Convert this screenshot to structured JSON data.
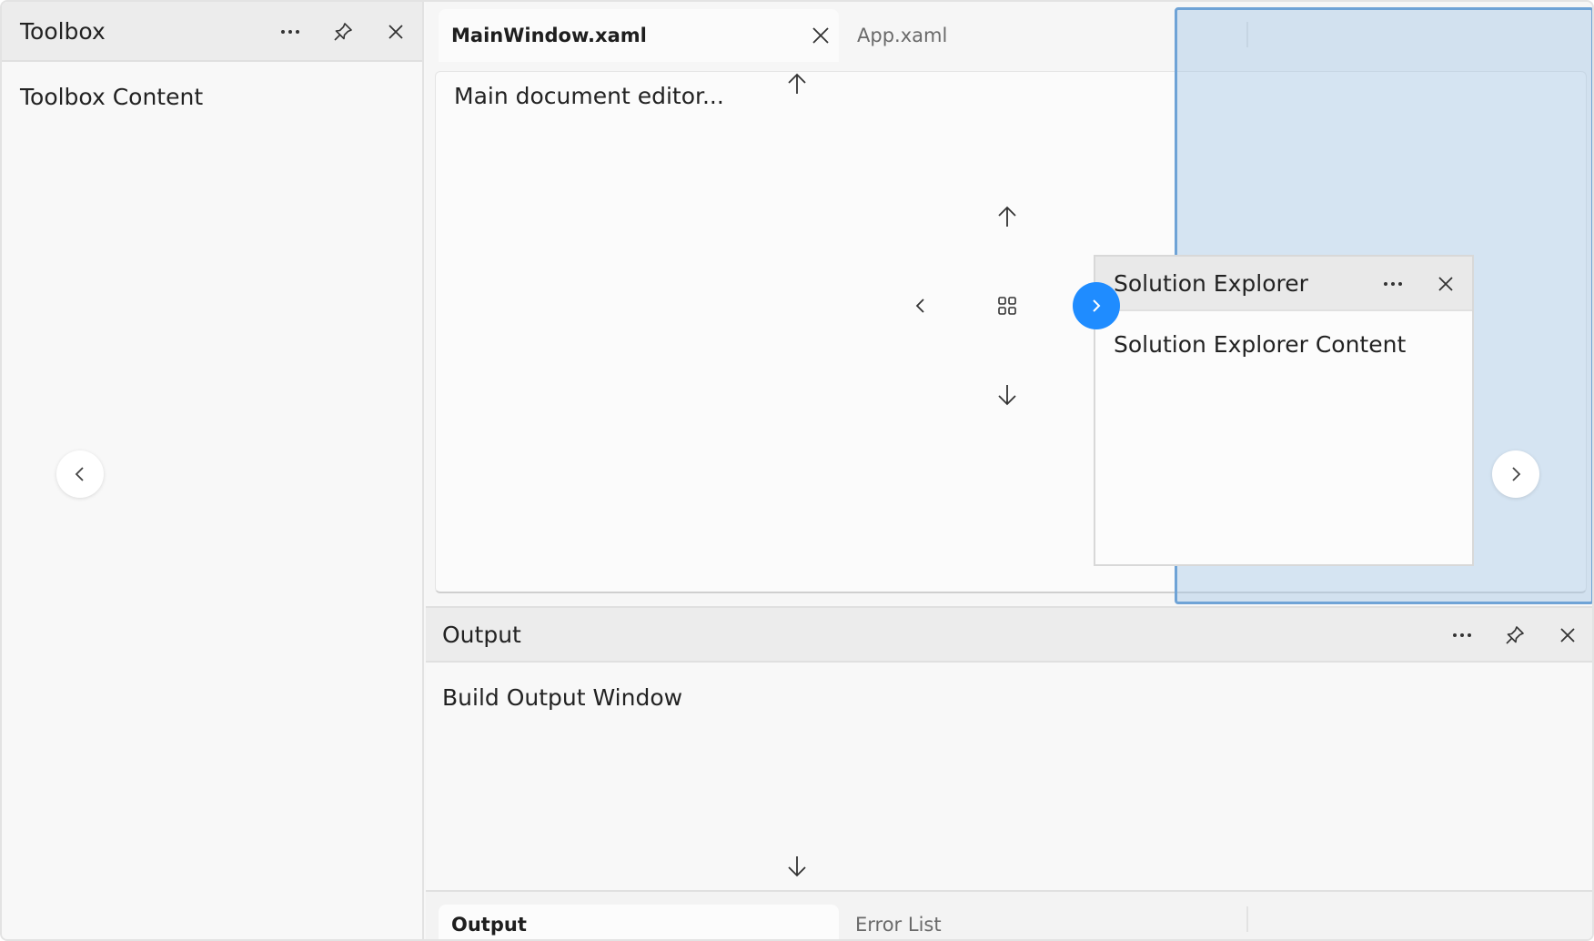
{
  "toolbox": {
    "title": "Toolbox",
    "content": "Toolbox Content"
  },
  "document": {
    "tabs": [
      {
        "label": "MainWindow.xaml",
        "active": true
      },
      {
        "label": "App.xaml",
        "active": false
      }
    ],
    "editor_text": "Main document editor..."
  },
  "solution_explorer": {
    "title": "Solution Explorer",
    "content": "Solution Explorer Content"
  },
  "output": {
    "title": "Output",
    "content": "Build Output Window",
    "tabs": [
      {
        "label": "Output",
        "active": true
      },
      {
        "label": "Error List",
        "active": false
      }
    ]
  },
  "colors": {
    "accent": "#1f8cff",
    "dropzone": "#a0c3e4",
    "dropzone_border": "#6fa3d6"
  },
  "icons": {
    "more": "more-icon",
    "pin": "pin-icon",
    "close": "close-icon",
    "arrow_up": "arrow-up-icon",
    "arrow_down": "arrow-down-icon",
    "chevron_left": "chevron-left-icon",
    "chevron_right": "chevron-right-icon",
    "dock_center": "dock-center-icon"
  }
}
